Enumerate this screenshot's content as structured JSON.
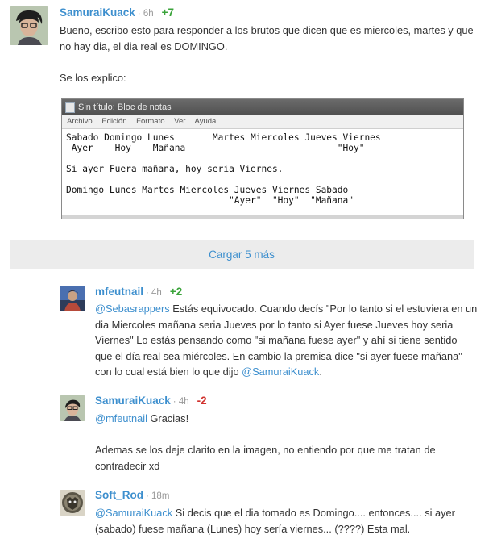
{
  "comments": [
    {
      "author": "SamuraiKuack",
      "time": "· 6h",
      "votes": "+7",
      "lines": [
        "Bueno, escribo esto para responder a los brutos que dicen que es miercoles, martes y que",
        "no hay dia, el dia real es DOMINGO.",
        "",
        "Se los explico:"
      ]
    },
    {
      "author": "mfeutnail",
      "time": "· 4h",
      "votes": "+2",
      "mention": "@Sebasrappers",
      "lines": [
        " Estás equivocado. Cuando decís \"Por lo tanto si el estuviera en un",
        "dia Miercoles mañana seria Jueves por lo tanto si Ayer fuese Jueves hoy seria",
        "Viernes\" Lo estás pensando como \"si mañana fuese ayer\" y ahí si tiene sentido",
        "que el día real sea miércoles. En cambio la premisa dice \"si ayer fuese mañana\"",
        "con lo cual está bien lo que dijo "
      ],
      "end_mention": "@SamuraiKuack",
      "end_text": "."
    },
    {
      "author": "SamuraiKuack",
      "time": "· 4h",
      "votes": "-2",
      "mention": "@mfeutnail",
      "lines": [
        " Gracias!",
        "",
        "Ademas se los deje clarito en la imagen, no entiendo por que me tratan de",
        "contradecir xd"
      ]
    },
    {
      "author": "Soft_Rod",
      "time": "· 18m",
      "mention": "@SamuraiKuack",
      "lines": [
        " Si decis que el dia tomado es Domingo.... entonces.... si ayer",
        "(sabado) fuese mañana (Lunes) hoy sería viernes... (????) Esta mal."
      ]
    }
  ],
  "load_more": "Cargar 5 más",
  "notepad": {
    "title": "Sin título: Bloc de notas",
    "menu": [
      "Archivo",
      "Edición",
      "Formato",
      "Ver",
      "Ayuda"
    ],
    "text": "Sabado Domingo Lunes       Martes Miercoles Jueves Viernes\n Ayer    Hoy    Mañana                            \"Hoy\"\n\nSi ayer Fuera mañana, hoy seria Viernes.\n\nDomingo Lunes Martes Miercoles Jueves Viernes Sabado\n                              \"Ayer\"  \"Hoy\"  \"Mañana\""
  },
  "colors": {
    "link": "#3d8fce",
    "positive": "#3aa33a",
    "negative": "#d0312d"
  }
}
